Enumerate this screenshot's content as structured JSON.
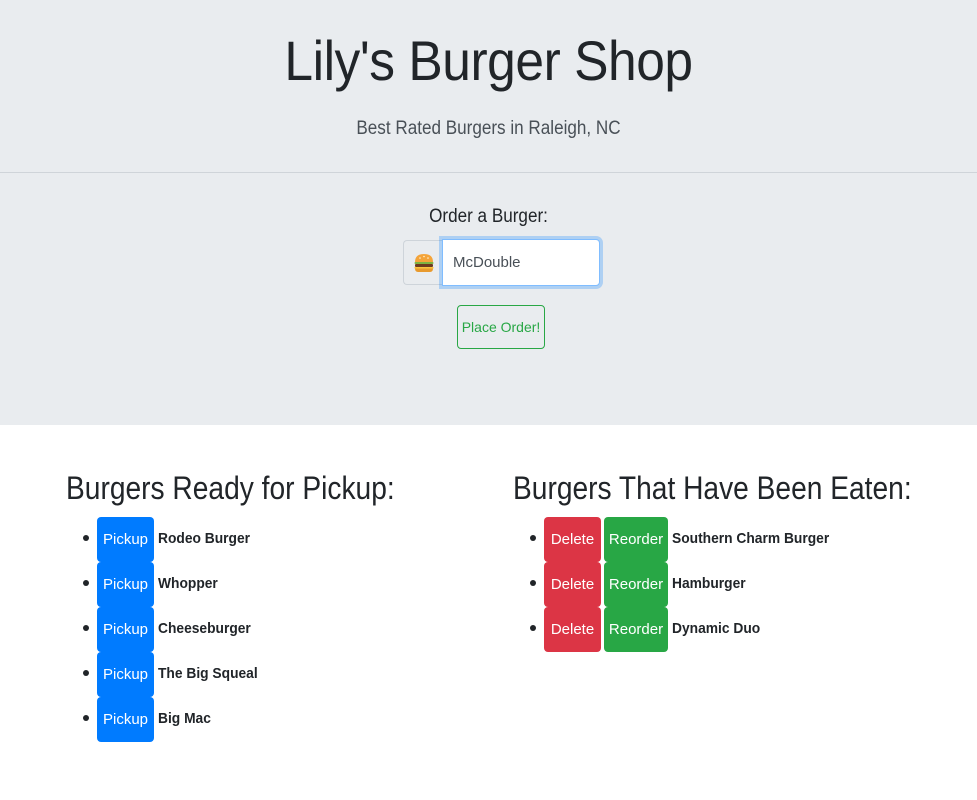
{
  "header": {
    "title": "Lily's Burger Shop",
    "tagline": "Best Rated Burgers in Raleigh, NC"
  },
  "order_form": {
    "label": "Order a Burger:",
    "icon": "burger-emoji",
    "input_value": "McDouble",
    "submit_label": "Place Order!"
  },
  "ready": {
    "heading": "Burgers Ready for Pickup:",
    "button_label": "Pickup",
    "items": [
      "Rodeo Burger",
      "Whopper",
      "Cheeseburger",
      "The Big Squeal",
      "Big Mac"
    ]
  },
  "eaten": {
    "heading": "Burgers That Have Been Eaten:",
    "delete_label": "Delete",
    "reorder_label": "Reorder",
    "items": [
      "Southern Charm Burger",
      "Hamburger",
      "Dynamic Duo"
    ]
  },
  "colors": {
    "jumbotron_bg": "#e9ecef",
    "primary": "#007bff",
    "success": "#28a745",
    "danger": "#dc3545"
  }
}
